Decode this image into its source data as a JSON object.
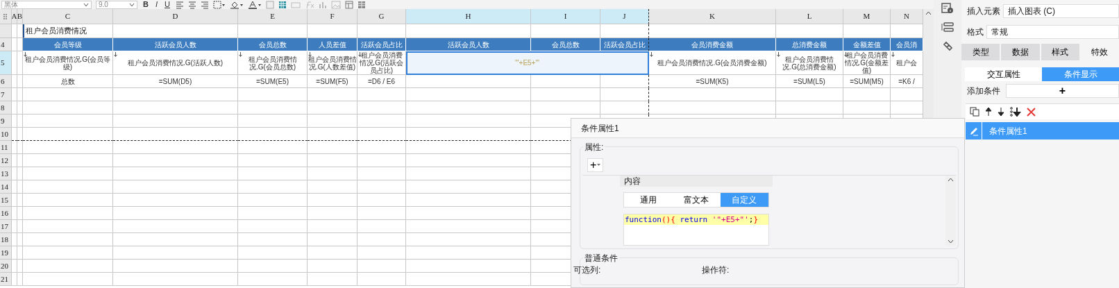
{
  "toolbar": {
    "font_name": "黑体",
    "font_size": "9.0",
    "style_buttons": [
      {
        "label": "B",
        "kind": "bold"
      },
      {
        "label": "I",
        "kind": "italic"
      },
      {
        "label": "U",
        "kind": "underline"
      }
    ]
  },
  "columns": [
    {
      "label": "A",
      "selected": false
    },
    {
      "label": "B",
      "selected": false
    },
    {
      "label": "C",
      "selected": false
    },
    {
      "label": "D",
      "selected": false
    },
    {
      "label": "E",
      "selected": false
    },
    {
      "label": "F",
      "selected": false
    },
    {
      "label": "G",
      "selected": false
    },
    {
      "label": "H",
      "selected": true
    },
    {
      "label": "I",
      "selected": true
    },
    {
      "label": "J",
      "selected": true,
      "page_break": true
    },
    {
      "label": "K",
      "selected": false
    },
    {
      "label": "L",
      "selected": false
    },
    {
      "label": "M",
      "selected": false
    },
    {
      "label": "N",
      "selected": false
    }
  ],
  "rows": [
    {
      "number": "",
      "selected": false,
      "cells": [
        {
          "text": "租户会员消费情况",
          "kind": "title"
        }
      ]
    },
    {
      "number": "4",
      "selected": false,
      "cells": [
        {
          "text": "会员等级",
          "kind": "header"
        },
        {
          "text": "活跃会员人数",
          "kind": "header"
        },
        {
          "text": "会员总数",
          "kind": "header"
        },
        {
          "text": "人员差值",
          "kind": "header"
        },
        {
          "text": "活跃会员占比",
          "kind": "header"
        },
        {
          "text": "活跃会员人数",
          "kind": "header"
        },
        {
          "text": "会员总数",
          "kind": "header"
        },
        {
          "text": "活跃会员占比",
          "kind": "header"
        },
        {
          "text": "会员消费金额",
          "kind": "header"
        },
        {
          "text": "总消费金额",
          "kind": "header"
        },
        {
          "text": "金额差值",
          "kind": "header"
        },
        {
          "text": "会员消",
          "kind": "header"
        }
      ]
    },
    {
      "number": "5",
      "selected": true,
      "cells": [
        {
          "text": "租户会员消费情况.G(会员等级)",
          "kind": "data",
          "expand": true,
          "selected": false
        },
        {
          "text": "租户会员消费情况.G(活跃人数)",
          "kind": "data",
          "expand": true,
          "selected": false
        },
        {
          "text": "租户会员消费情况.G(会员总数)",
          "kind": "data",
          "expand": true,
          "selected": false
        },
        {
          "text": "租户会员消费情况.G(人数差值)",
          "kind": "data",
          "expand": true,
          "selected": false
        },
        {
          "text": "租户会员消费情况.G(活跃会员占比)",
          "kind": "data",
          "expand": true,
          "selected": false
        },
        {
          "text": "'\"+E5+\"'",
          "kind": "merged",
          "expand": false,
          "selected": true
        },
        {
          "text": "租户会员消费情况.G(会员消费金额)",
          "kind": "data",
          "expand": true,
          "selected": false
        },
        {
          "text": "租户会员消费情况.G(总消费金额)",
          "kind": "data",
          "expand": true,
          "selected": false
        },
        {
          "text": "租户会员消费情况.G(金额差值)",
          "kind": "data",
          "expand": true,
          "selected": false
        },
        {
          "text": "租户会",
          "kind": "data",
          "expand": true,
          "selected": false
        }
      ]
    },
    {
      "number": "6",
      "selected": false,
      "cells": [
        {
          "text": "总数",
          "kind": "data"
        },
        {
          "text": "=SUM(D5)",
          "kind": "data"
        },
        {
          "text": "=SUM(E5)",
          "kind": "data"
        },
        {
          "text": "=SUM(F5)",
          "kind": "data"
        },
        {
          "text": "=D6 / E6",
          "kind": "data"
        },
        {
          "kind": "blank"
        },
        {
          "kind": "blank"
        },
        {
          "kind": "blank"
        },
        {
          "text": "=SUM(K5)",
          "kind": "data"
        },
        {
          "text": "=SUM(L5)",
          "kind": "data"
        },
        {
          "text": "=SUM(M5)",
          "kind": "data"
        },
        {
          "text": "=K6 /",
          "kind": "data"
        }
      ]
    },
    {
      "number": "7",
      "selected": false
    },
    {
      "number": "8",
      "selected": false
    },
    {
      "number": "9",
      "selected": false
    },
    {
      "number": "10",
      "selected": false,
      "page_break": true
    },
    {
      "number": "11",
      "selected": false
    },
    {
      "number": "12",
      "selected": false
    },
    {
      "number": "13",
      "selected": false
    },
    {
      "number": "14",
      "selected": false
    },
    {
      "number": "15",
      "selected": false
    },
    {
      "number": "16",
      "selected": false
    },
    {
      "number": "17",
      "selected": false
    },
    {
      "number": "18",
      "selected": false
    },
    {
      "number": "19",
      "selected": false
    },
    {
      "number": "20",
      "selected": false
    },
    {
      "number": "21",
      "selected": false
    }
  ],
  "panel": {
    "insert_label": "插入元素",
    "insert_value": "插入图表 (C)",
    "format_label": "格式",
    "format_value": "常规",
    "tabs": [
      {
        "label": "类型",
        "selected": false
      },
      {
        "label": "数据",
        "selected": false
      },
      {
        "label": "样式",
        "selected": false
      },
      {
        "label": "特效",
        "selected": true
      }
    ],
    "subtabs": [
      {
        "label": "交互属性",
        "selected": false
      },
      {
        "label": "条件显示",
        "selected": true
      }
    ],
    "add_label": "添加条件",
    "add_button": "+",
    "conditions": [
      {
        "label": "条件属性1",
        "selected": true
      }
    ]
  },
  "dialog": {
    "title": "条件属性1",
    "section": "属性:",
    "add_button": "+",
    "field_label": "内容",
    "tabs": [
      {
        "label": "通用",
        "selected": false
      },
      {
        "label": "富文本",
        "selected": false
      },
      {
        "label": "自定义",
        "selected": true
      }
    ],
    "code": [
      {
        "text": "function",
        "kind": "keyword"
      },
      {
        "text": "(){",
        "kind": "bracket"
      },
      {
        "text": " return ",
        "kind": "keyword"
      },
      {
        "text": "'\"+E5+\"'",
        "kind": "string"
      },
      {
        "text": ";",
        "kind": "plain"
      },
      {
        "text": "}",
        "kind": "bracket"
      }
    ],
    "section2": "普通条件",
    "labels": [
      "可选列:",
      "操作符:"
    ]
  }
}
